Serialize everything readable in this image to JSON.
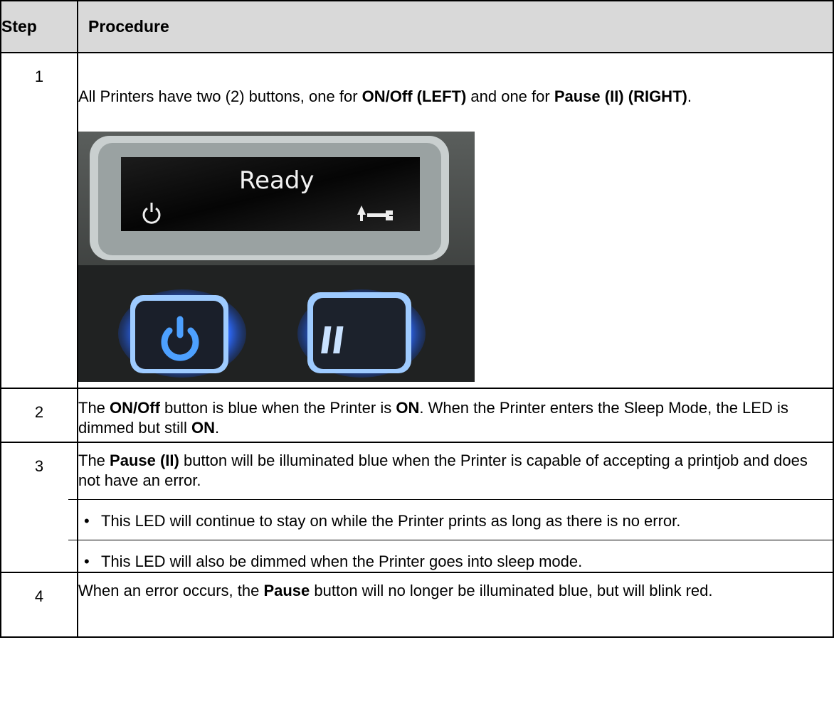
{
  "table": {
    "header": {
      "step": "Step",
      "procedure": "Procedure"
    },
    "rows": [
      {
        "step": "1",
        "text": {
          "a": "All Printers have two (2) buttons, one for ",
          "b": "ON/Off (LEFT)",
          "c": " and one for ",
          "d": "Pause (II) (RIGHT)",
          "e": "."
        },
        "image": {
          "display_text": "Ready",
          "left_icon": "power-icon",
          "right_icon": "arrow-wrench-icon",
          "left_button_icon": "power-icon",
          "right_button_icon": "pause-icon",
          "glow_color": "#3a7bff"
        }
      },
      {
        "step": "2",
        "text": {
          "a": "The ",
          "b": "ON/Off",
          "c": " button is blue when the Printer is ",
          "d": "ON",
          "e": ". When the Printer enters the Sleep Mode, the LED is dimmed but still ",
          "f": "ON",
          "g": "."
        }
      },
      {
        "step": "3",
        "text": {
          "a": "The ",
          "b": "Pause (II)",
          "c": " button will be illuminated blue when the Printer is capable of accepting a printjob and does not have an error."
        },
        "bullets": [
          "This LED will continue to stay on while the Printer prints as long as there is no error.",
          "This LED will also be dimmed when the Printer goes into sleep mode."
        ]
      },
      {
        "step": "4",
        "text": {
          "a": "When an error occurs, the ",
          "b": "Pause",
          "c": " button will no longer be illuminated blue, but will blink red."
        }
      }
    ]
  }
}
